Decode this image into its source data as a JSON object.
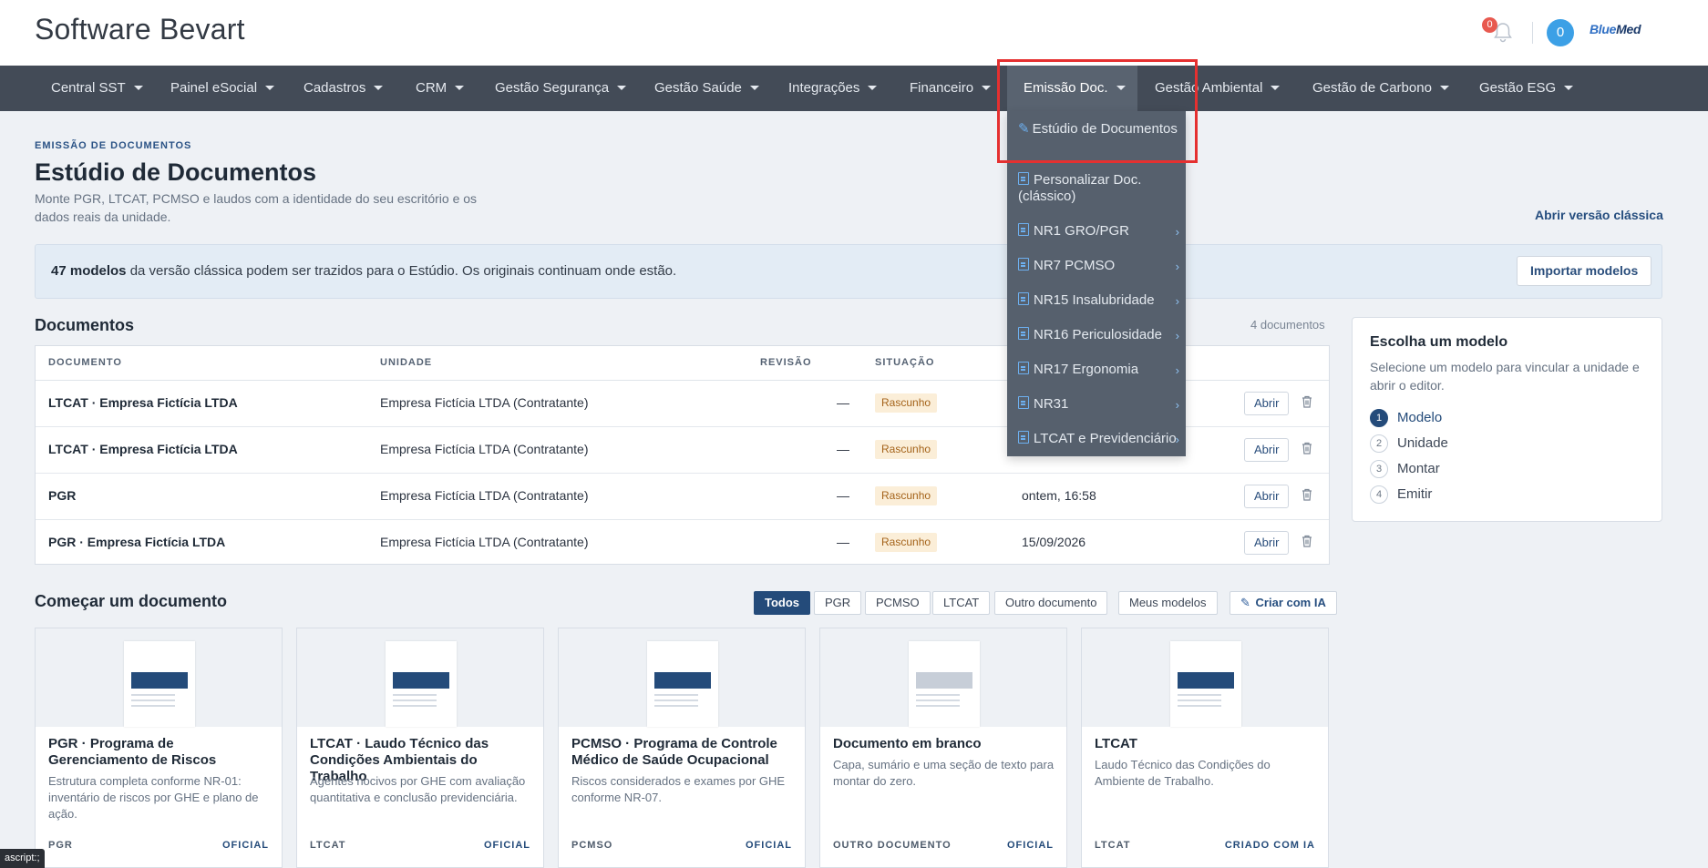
{
  "app": {
    "title": "Software Bevart",
    "notifications_count": "0",
    "user_count": "0",
    "brand_part1": "Blue",
    "brand_part2": "Med"
  },
  "nav": [
    {
      "label": "Central SST"
    },
    {
      "label": "Painel eSocial"
    },
    {
      "label": "Cadastros"
    },
    {
      "label": "CRM"
    },
    {
      "label": "Gestão Segurança"
    },
    {
      "label": "Gestão Saúde"
    },
    {
      "label": "Integrações"
    },
    {
      "label": "Financeiro"
    },
    {
      "label": "Emissão Doc."
    },
    {
      "label": "Gestão Ambiental"
    },
    {
      "label": "Gestão de Carbono"
    },
    {
      "label": "Gestão ESG"
    }
  ],
  "dropdown": {
    "items": [
      {
        "label": "Estúdio de Documentos",
        "icon": "magic-wand-icon"
      },
      {
        "label": "Personalizar Doc. (clássico)",
        "icon": "document-icon"
      },
      {
        "label": "NR1 GRO/PGR",
        "icon": "document-icon"
      },
      {
        "label": "NR7 PCMSO",
        "icon": "document-icon"
      },
      {
        "label": "NR15 Insalubridade",
        "icon": "document-icon"
      },
      {
        "label": "NR16 Periculosidade",
        "icon": "document-icon"
      },
      {
        "label": "NR17 Ergonomia",
        "icon": "document-icon"
      },
      {
        "label": "NR31",
        "icon": "document-icon"
      },
      {
        "label": "LTCAT e Previdenciário",
        "icon": "document-icon"
      }
    ]
  },
  "page": {
    "eyebrow": "EMISSÃO DE DOCUMENTOS",
    "title": "Estúdio de Documentos",
    "description": "Monte PGR, LTCAT, PCMSO e laudos com a identidade do seu escritório e os dados reais da unidade.",
    "classic_link": "Abrir versão clássica"
  },
  "banner": {
    "count_text": "47 modelos",
    "text": " da versão clássica podem ser trazidos para o Estúdio. Os originais continuam onde estão.",
    "button": "Importar modelos"
  },
  "documents": {
    "title": "Documentos",
    "count": "4 documentos",
    "headers": {
      "document": "DOCUMENTO",
      "unit": "UNIDADE",
      "revision": "REVISÃO",
      "status": "SITUAÇÃO"
    },
    "open_label": "Abrir",
    "rows": [
      {
        "name": "LTCAT · Empresa Fictícia LTDA",
        "unit": "Empresa Fictícia LTDA (Contratante)",
        "revision": "—",
        "status": "Rascunho",
        "date": ""
      },
      {
        "name": "LTCAT · Empresa Fictícia LTDA",
        "unit": "Empresa Fictícia LTDA (Contratante)",
        "revision": "—",
        "status": "Rascunho",
        "date": ""
      },
      {
        "name": "PGR",
        "unit": "Empresa Fictícia LTDA (Contratante)",
        "revision": "—",
        "status": "Rascunho",
        "date": "ontem, 16:58"
      },
      {
        "name": "PGR · Empresa Fictícia LTDA",
        "unit": "Empresa Fictícia LTDA (Contratante)",
        "revision": "—",
        "status": "Rascunho",
        "date": "15/09/2026"
      }
    ]
  },
  "side": {
    "title": "Escolha um modelo",
    "description": "Selecione um modelo para vincular a unidade e abrir o editor.",
    "steps": [
      {
        "num": "1",
        "label": "Modelo"
      },
      {
        "num": "2",
        "label": "Unidade"
      },
      {
        "num": "3",
        "label": "Montar"
      },
      {
        "num": "4",
        "label": "Emitir"
      }
    ]
  },
  "start": {
    "title": "Começar um documento",
    "filters": [
      "Todos",
      "PGR",
      "PCMSO",
      "LTCAT",
      "Outro documento",
      "Meus modelos"
    ],
    "ai_button": "Criar com IA",
    "cards": [
      {
        "title": "PGR · Programa de Gerenciamento de Riscos",
        "description": "Estrutura completa conforme NR-01: inventário de riscos por GHE e plano de ação.",
        "tag": "PGR",
        "source": "OFICIAL"
      },
      {
        "title": "LTCAT · Laudo Técnico das Condições Ambientais do Trabalho",
        "description": "Agentes nocivos por GHE com avaliação quantitativa e conclusão previdenciária.",
        "tag": "LTCAT",
        "source": "OFICIAL"
      },
      {
        "title": "PCMSO · Programa de Controle Médico de Saúde Ocupacional",
        "description": "Riscos considerados e exames por GHE conforme NR-07.",
        "tag": "PCMSO",
        "source": "OFICIAL"
      },
      {
        "title": "Documento em branco",
        "description": "Capa, sumário e uma seção de texto para montar do zero.",
        "tag": "OUTRO DOCUMENTO",
        "source": "OFICIAL"
      },
      {
        "title": "LTCAT",
        "description": "Laudo Técnico das Condições do Ambiente de Trabalho.",
        "tag": "LTCAT",
        "source": "CRIADO COM IA"
      }
    ]
  },
  "status_tip": "ascript:;",
  "colors": {
    "nav_bg": "#434b57",
    "accent": "#244b7a",
    "highlight": "#e53030",
    "badge_bg": "#fbeed8"
  }
}
